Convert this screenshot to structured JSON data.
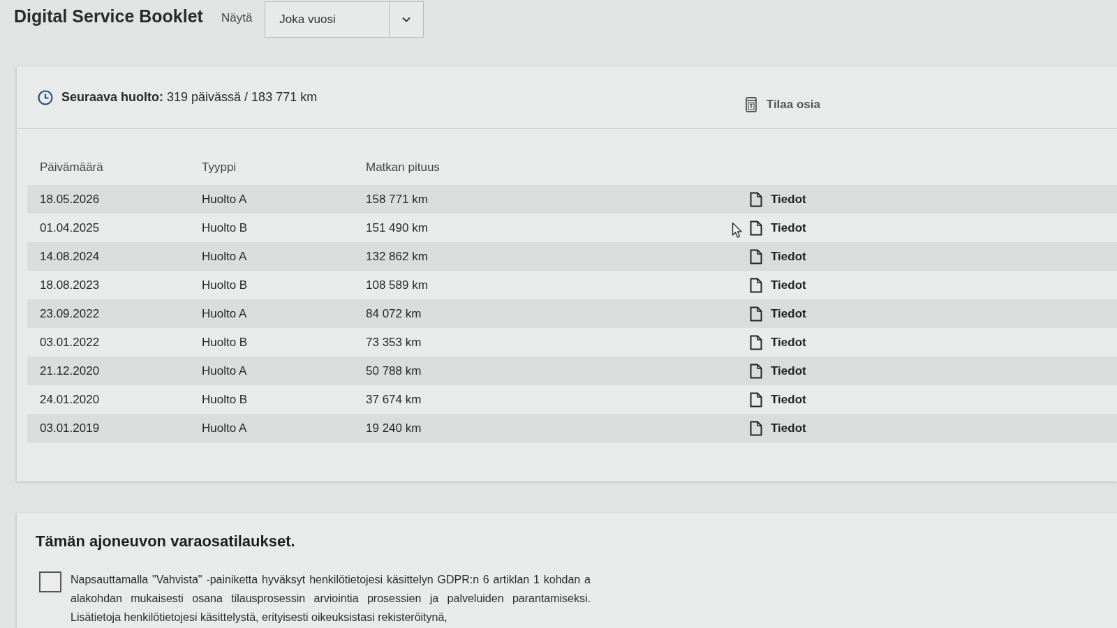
{
  "header": {
    "title": "Digital Service Booklet",
    "filter": {
      "label": "Näytä",
      "value": "Joka vuosi"
    }
  },
  "next_service": {
    "text": "**Seuraava huolto:** 319 päivässä / 183 771 km",
    "action": "Tilaa osia"
  },
  "table": {
    "columns": [
      "Päivämäärä",
      "Tyyppi",
      "Matkan pituus"
    ],
    "rows": [
      {
        "date": "18.05.2026",
        "type": "Huolto A",
        "distance": "158 771 km",
        "link": "Tiedot"
      },
      {
        "date": "01.04.2025",
        "type": "Huolto B",
        "distance": "151 490 km",
        "link": "Tiedot"
      },
      {
        "date": "14.08.2024",
        "type": "Huolto A",
        "distance": "132 862 km",
        "link": "Tiedot"
      },
      {
        "date": "18.08.2023",
        "type": "Huolto B",
        "distance": "108 589 km",
        "link": "Tiedot"
      },
      {
        "date": "23.09.2022",
        "type": "Huolto A",
        "distance": "84 072 km",
        "link": "Tiedot"
      },
      {
        "date": "03.01.2022",
        "type": "Huolto B",
        "distance": "73 353 km",
        "link": "Tiedot"
      },
      {
        "date": "21.12.2020",
        "type": "Huolto A",
        "distance": "50 788 km",
        "link": "Tiedot"
      },
      {
        "date": "24.01.2020",
        "type": "Huolto B",
        "distance": "37 674 km",
        "link": "Tiedot"
      },
      {
        "date": "03.01.2019",
        "type": "Huolto A",
        "distance": "19 240 km",
        "link": "Tiedot"
      }
    ]
  },
  "parts_orders": {
    "heading": "Tämän ajoneuvon varaosatilaukset.",
    "consent": {
      "checked": false,
      "text": "Napsauttamalla \"Vahvista\" -painiketta hyväksyt henkilötietojesi käsittelyn GDPR:n 6 artiklan 1 kohdan a alakohdan mukaisesti osana tilausprosessin arviointia prosessien ja palveluiden parantamiseksi. Lisätietoja henkilötietojesi käsittelystä, erityisesti oikeuksistasi rekisteröitynä,"
    }
  }
}
